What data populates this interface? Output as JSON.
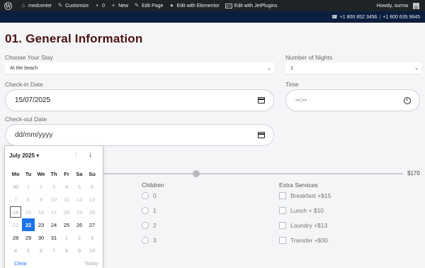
{
  "adminbar": {
    "site": "medcenter",
    "customize": "Customize",
    "comments": "0",
    "new": "New",
    "edit_page": "Edit Page",
    "elementor": "Edit with Elementor",
    "jetplugins": "Edit with JetPlugins",
    "jet_badge": "JET",
    "howdy": "Howdy, surma"
  },
  "topbar": {
    "phone1": "+1 800 852 3456",
    "divider": "|",
    "phone2": "+1 800 635 9645"
  },
  "page": {
    "title": "01. General Information"
  },
  "form": {
    "stay_label": "Choose Your Stay",
    "stay_value": "At the beach",
    "nights_label": "Number of Nights",
    "nights_value": "1",
    "checkin_label": "Check-in Date",
    "checkin_value": "15/07/2025",
    "time_label": "Time",
    "time_value": "--:--",
    "checkout_label": "Check-out Date",
    "checkout_placeholder": "dd/mm/yyyy",
    "price_max": "$170",
    "children_title": "Children",
    "children_options": [
      "0",
      "1",
      "2",
      "3"
    ],
    "extras_title": "Extra Services",
    "extras_options": [
      "Breakfast +$15",
      "Lunch + $10",
      "Laundry +$13",
      "Transfer +$30"
    ]
  },
  "datepicker": {
    "month": "July 2025 ▾",
    "weekdays": [
      "Mo",
      "Tu",
      "We",
      "Th",
      "Fr",
      "Sa",
      "Su"
    ],
    "rows": [
      [
        "30",
        "1",
        "2",
        "3",
        "4",
        "5",
        "6"
      ],
      [
        "7",
        "8",
        "9",
        "10",
        "11",
        "12",
        "13"
      ],
      [
        "14",
        "15",
        "16",
        "17",
        "18",
        "19",
        "20"
      ],
      [
        "21",
        "22",
        "23",
        "24",
        "25",
        "26",
        "27"
      ],
      [
        "28",
        "29",
        "30",
        "31",
        "1",
        "2",
        "3"
      ],
      [
        "4",
        "5",
        "6",
        "7",
        "8",
        "9",
        "10"
      ]
    ],
    "clear": "Clear",
    "today": "Today",
    "accent": "#1a73e8"
  },
  "colors": {
    "title": "#4a1111",
    "topbar": "#0b1e3d",
    "adminbar": "#1d2327"
  }
}
